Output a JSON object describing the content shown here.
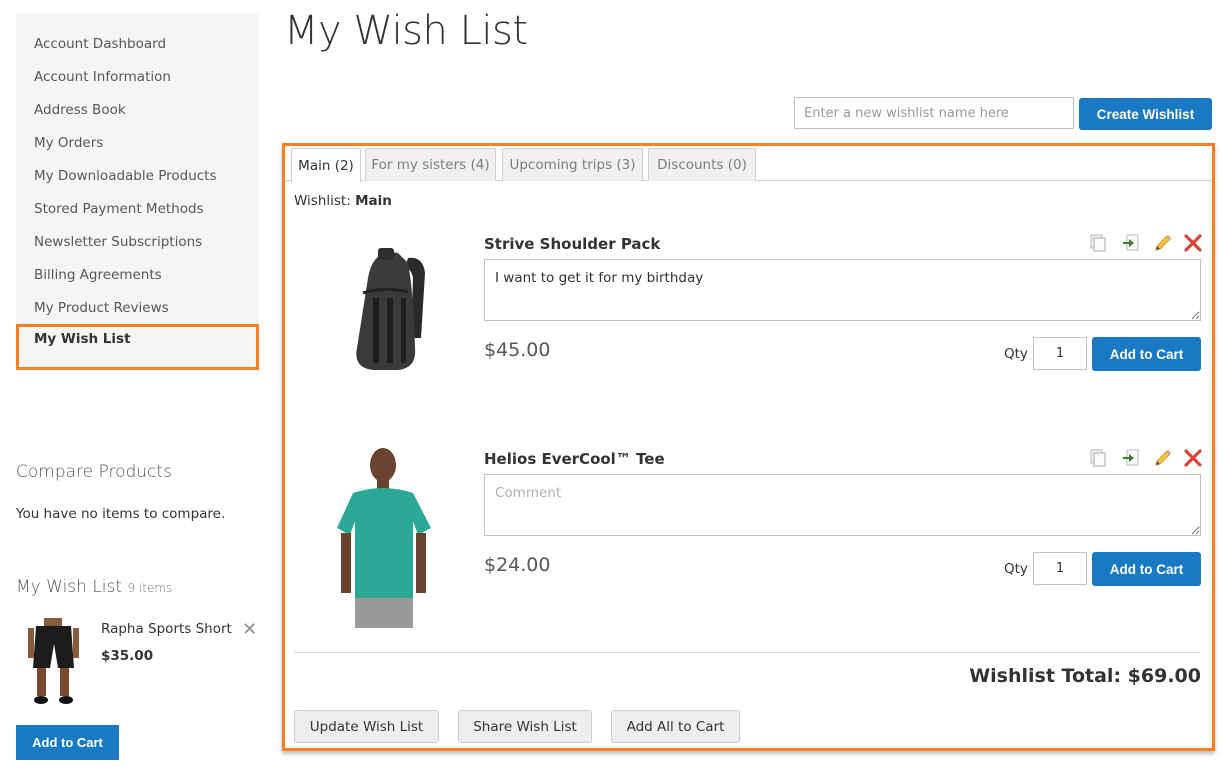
{
  "sidebar": {
    "nav_items": [
      "Account Dashboard",
      "Account Information",
      "Address Book",
      "My Orders",
      "My Downloadable Products",
      "Stored Payment Methods",
      "Newsletter Subscriptions",
      "Billing Agreements",
      "My Product Reviews"
    ],
    "active_item": "My Wish List",
    "compare": {
      "title": "Compare Products",
      "empty_text": "You have no items to compare."
    },
    "wishlist_block": {
      "title": "My Wish List",
      "count": "9 items",
      "item": {
        "name": "Rapha Sports Short",
        "price": "$35.00",
        "remove_icon": "close-icon"
      },
      "add_to_cart_label": "Add to Cart"
    }
  },
  "main": {
    "title": "My Wish List",
    "new_wishlist": {
      "placeholder": "Enter a new wishlist name here",
      "value": "",
      "create_label": "Create Wishlist"
    },
    "tabs": [
      {
        "label": "Main (2)",
        "active": true
      },
      {
        "label": "For my sisters (4)",
        "active": false
      },
      {
        "label": "Upcoming trips (3)",
        "active": false
      },
      {
        "label": "Discounts (0)",
        "active": false
      }
    ],
    "wishlist_label": "Wishlist:",
    "wishlist_name": "Main",
    "items": [
      {
        "name": "Strive Shoulder Pack",
        "comment": "I want to get it for my birthday",
        "comment_placeholder": "Comment",
        "price": "$45.00",
        "qty_label": "Qty",
        "qty": "1",
        "add_to_cart_label": "Add to Cart"
      },
      {
        "name": "Helios EverCool™ Tee",
        "comment": "",
        "comment_placeholder": "Comment",
        "price": "$24.00",
        "qty_label": "Qty",
        "qty": "1",
        "add_to_cart_label": "Add to Cart"
      }
    ],
    "item_actions": [
      "copy-icon",
      "move-icon",
      "edit-icon",
      "remove-icon"
    ],
    "total_label": "Wishlist Total:",
    "total_value": "$69.00",
    "buttons": {
      "update": "Update Wish List",
      "share": "Share Wish List",
      "add_all": "Add All to Cart"
    }
  },
  "colors": {
    "accent_blue": "#1979c3",
    "highlight_orange": "#f58025",
    "remove_red": "#d9453a",
    "move_green": "#3a7d2c"
  }
}
